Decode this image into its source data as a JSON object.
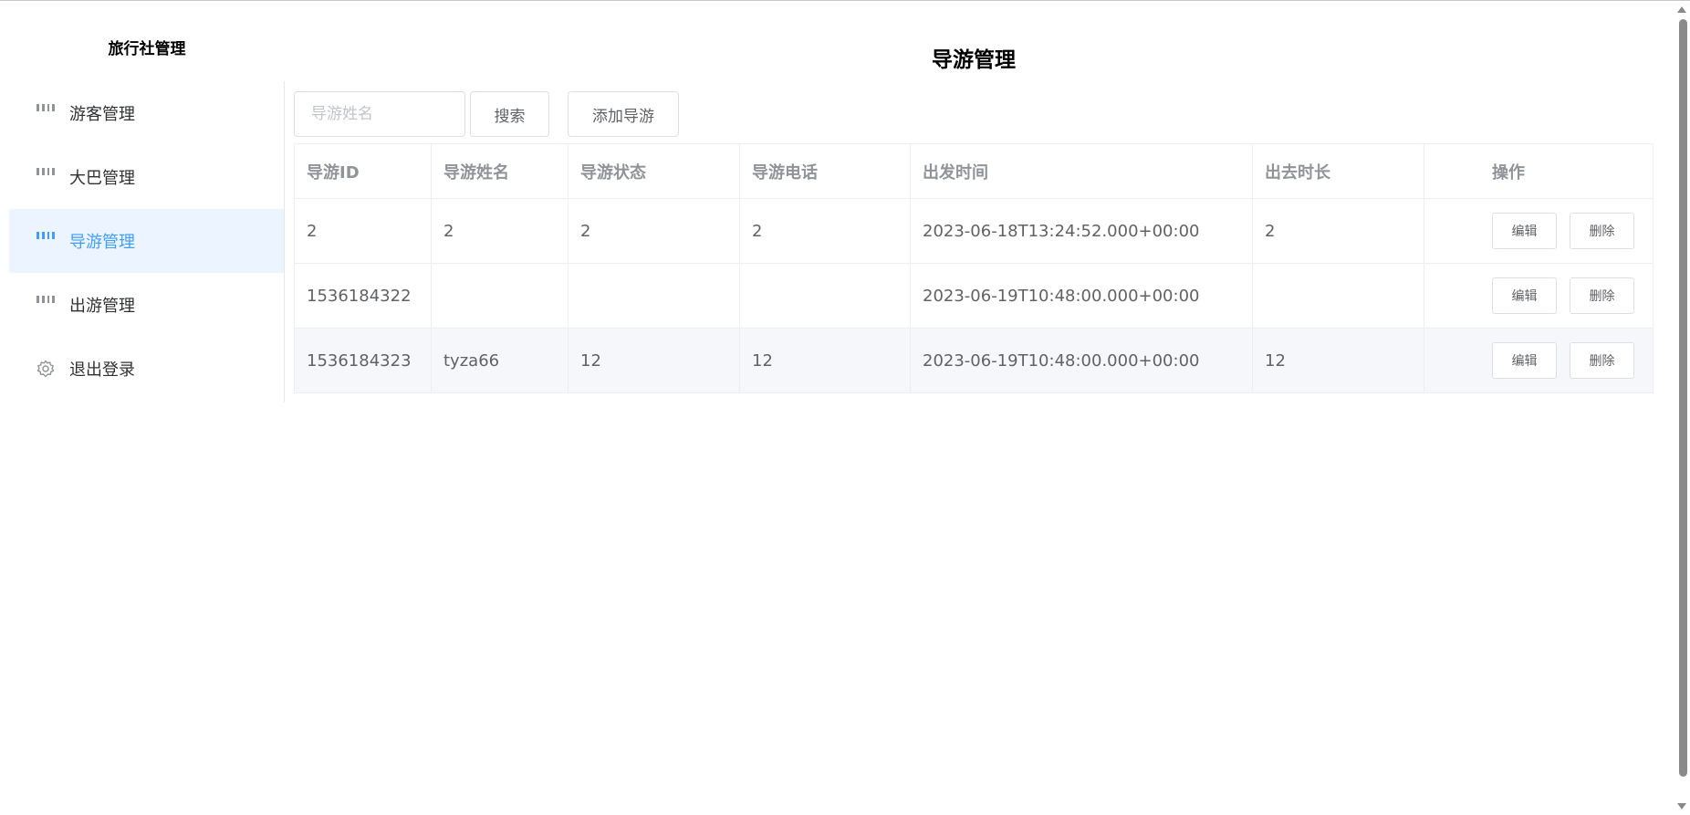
{
  "sidebar": {
    "brand": "旅行社管理",
    "items": [
      {
        "label": "游客管理",
        "icon": "grid-icon",
        "active": false
      },
      {
        "label": "大巴管理",
        "icon": "grid-icon",
        "active": false
      },
      {
        "label": "导游管理",
        "icon": "grid-icon",
        "active": true
      },
      {
        "label": "出游管理",
        "icon": "grid-icon",
        "active": false
      },
      {
        "label": "退出登录",
        "icon": "gear-icon",
        "active": false
      }
    ]
  },
  "main": {
    "title": "导游管理",
    "search": {
      "placeholder": "导游姓名",
      "value": ""
    },
    "search_button": "搜索",
    "add_button": "添加导游"
  },
  "table": {
    "headers": [
      "导游ID",
      "导游姓名",
      "导游状态",
      "导游电话",
      "出发时间",
      "出去时长",
      "操作"
    ],
    "rows": [
      [
        "2",
        "2",
        "2",
        "2",
        "2023-06-18T13:24:52.000+00:00",
        "2"
      ],
      [
        "1536184322",
        "",
        "",
        "",
        "2023-06-19T10:48:00.000+00:00",
        ""
      ],
      [
        "1536184323",
        "tyza66",
        "12",
        "12",
        "2023-06-19T10:48:00.000+00:00",
        "12"
      ]
    ],
    "edit_label": "编辑",
    "delete_label": "删除"
  },
  "colors": {
    "accent": "#409eff",
    "active_bg": "#ecf5ff",
    "stripe": "#f5f7fa"
  }
}
